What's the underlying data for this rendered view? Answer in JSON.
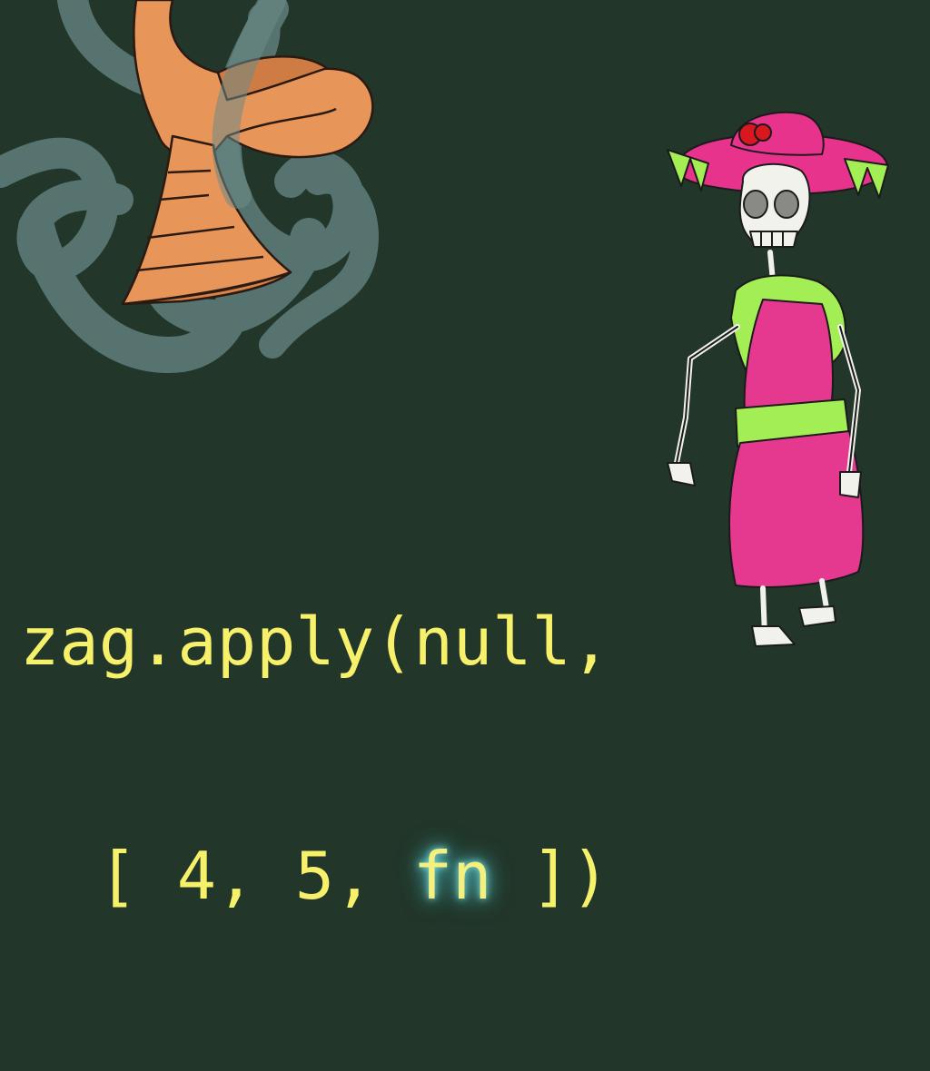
{
  "code": {
    "line1": "zag.apply(null,",
    "line2_open": "[ 4, 5, ",
    "line2_fn": "fn",
    "line2_close": " ])"
  },
  "colors": {
    "background": "#223629",
    "code_text": "#f7f06a",
    "fn_glow": "#7fe3e0",
    "smoke": "#5c7a78",
    "trumpet": "#e8955a",
    "dress": "#e5388f",
    "boa": "#a4ee55",
    "hat": "#e8338c",
    "rose": "#d8171f",
    "bone": "#f2f2ec"
  },
  "illustrations": {
    "left": "trumpet-horn-with-smoke",
    "right": "catrina-skeleton-in-pink-dress"
  }
}
